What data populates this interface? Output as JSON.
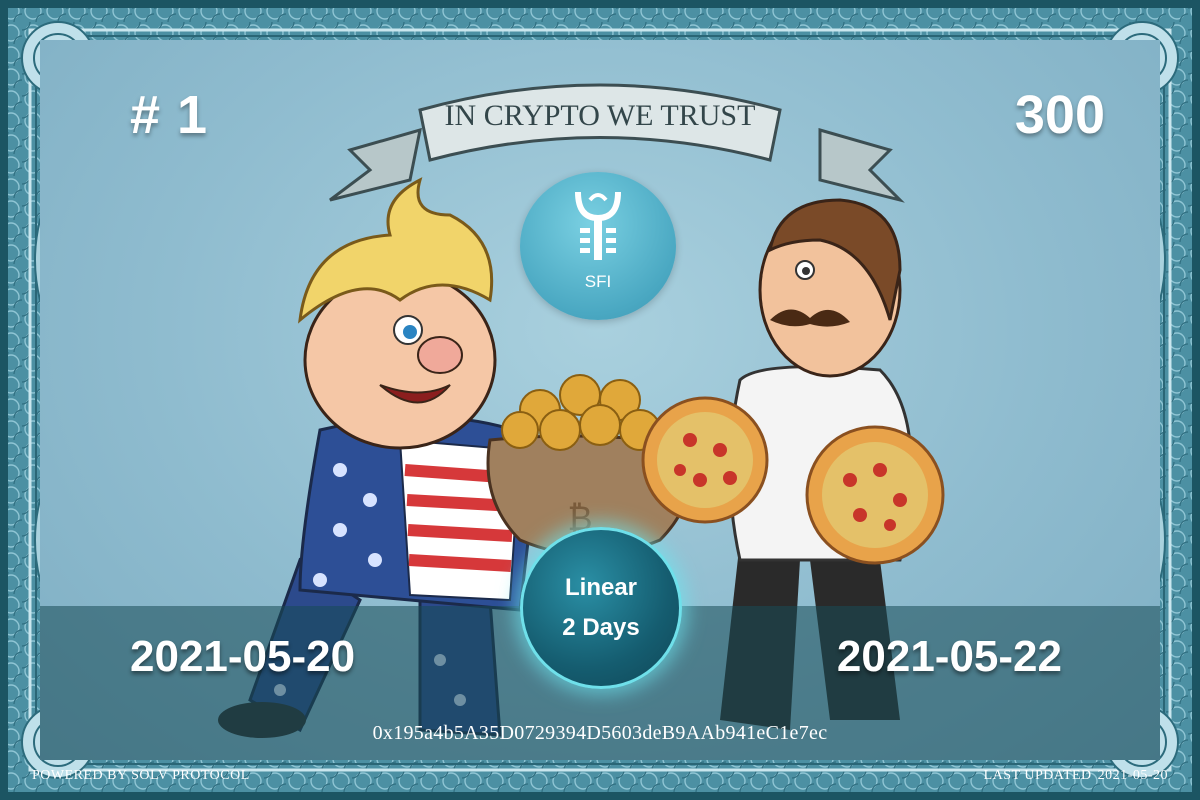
{
  "voucher": {
    "banner_text": "IN CRYPTO WE TRUST",
    "serial": "# 1",
    "amount": "300",
    "token_symbol": "SFI",
    "vesting_type": "Linear",
    "vesting_duration": "2 Days",
    "start_date": "2021-05-20",
    "end_date": "2021-05-22",
    "contract_address": "0x195a4b5A35D0729394D5603deB9AAb941eC1e7ec",
    "footer_left": "POWERED BY SOLV PROTOCOL",
    "footer_right_label": "LAST UPDATED",
    "footer_right_date": "2021-05-20"
  },
  "icons": [
    "ornate-frame",
    "ribbon-banner",
    "sfi-token-icon",
    "uncle-sam-character",
    "chef-character",
    "coin-sack",
    "pizza-icon"
  ],
  "colors": {
    "frame": "#4a8ea0",
    "field": "#8fbccf",
    "band": "#1f5f6c",
    "badge_glow": "#6fe0ea",
    "text": "#ffffff"
  }
}
